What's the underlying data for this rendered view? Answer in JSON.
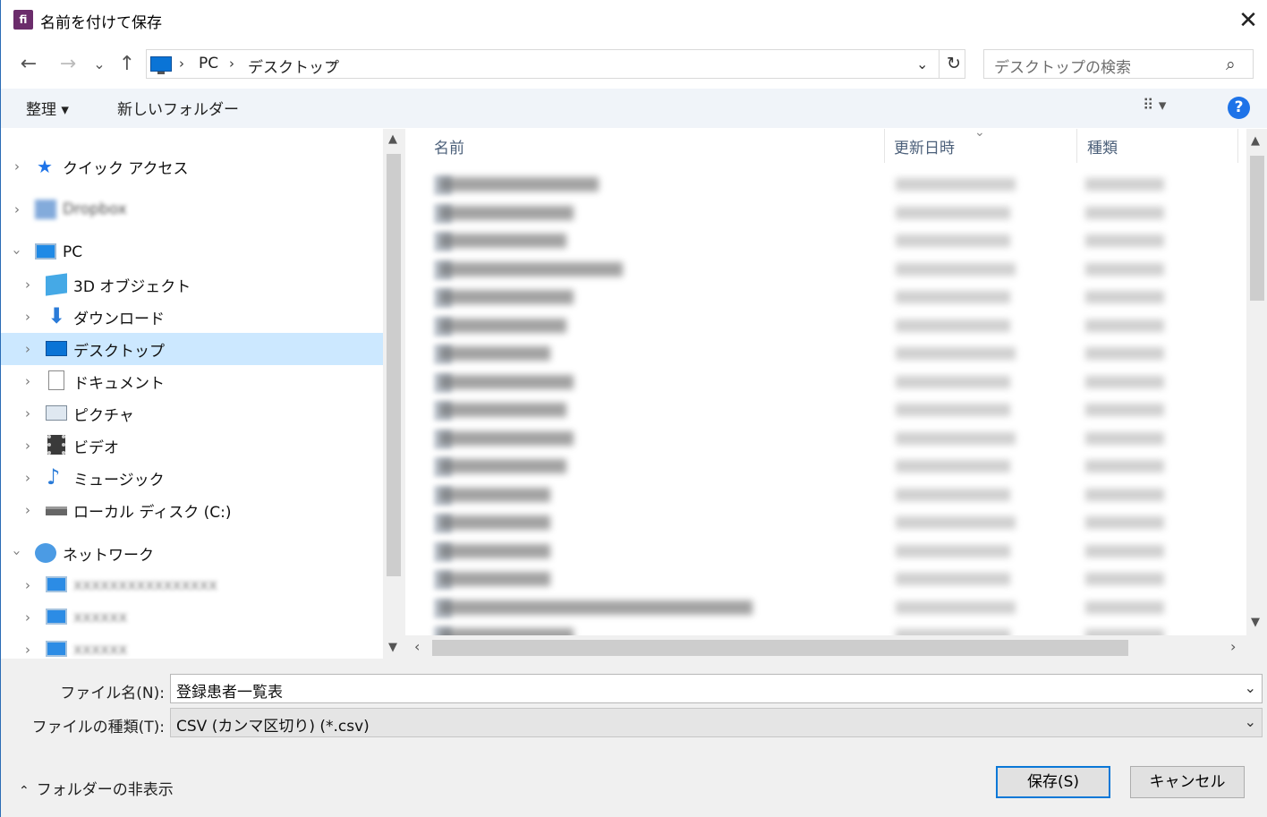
{
  "window": {
    "title": "名前を付けて保存",
    "app_icon_text": "fi",
    "accent": "#2b6cb5"
  },
  "nav_buttons": {
    "back": "←",
    "forward": "→",
    "recent": "⌄",
    "up": "↑"
  },
  "address": {
    "crumbs": [
      "PC",
      "デスクトップ"
    ],
    "sep": "›",
    "trailing_sep": "›",
    "dropdown": "⌄",
    "refresh": "↻"
  },
  "search": {
    "placeholder": "デスクトップの検索",
    "icon": "⌕"
  },
  "toolbar": {
    "organize_label": "整理 ▾",
    "new_folder_label": "新しいフォルダー",
    "view_label": "⠿ ▾",
    "help_label": "?"
  },
  "nav_pane": {
    "quick_access": "クイック アクセス",
    "blurred_item": "Dropbox",
    "pc": "PC",
    "pc_children": [
      "3D オブジェクト",
      "ダウンロード",
      "デスクトップ",
      "ドキュメント",
      "ピクチャ",
      "ビデオ",
      "ミュージック",
      "ローカル ディスク (C:)"
    ],
    "network": "ネットワーク",
    "network_children": [
      "xxxxxxxxxxxxxxxx",
      "xxxxxx",
      "xxxxxx"
    ]
  },
  "file_list": {
    "columns": {
      "name": "名前",
      "modified": "更新日時",
      "type": "種類"
    },
    "sort_indicator": "⌄"
  },
  "bottom": {
    "filename_label": "ファイル名(N):",
    "filename_value": "登録患者一覧表",
    "filetype_label": "ファイルの種類(T):",
    "filetype_value": "CSV (カンマ区切り) (*.csv)",
    "hide_folders_label": "フォルダーの非表示",
    "save_label": "保存(S)",
    "cancel_label": "キャンセル"
  }
}
